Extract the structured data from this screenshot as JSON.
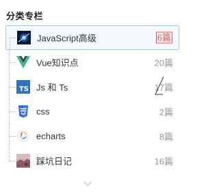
{
  "panel": {
    "title": "分类专栏"
  },
  "categories": [
    {
      "name": "JavaScript高级",
      "count": "6篇",
      "icon": "javascript-thumbnail-icon",
      "active": true
    },
    {
      "name": "Vue知识点",
      "count": "20篇",
      "icon": "vue-logo-icon",
      "active": false
    },
    {
      "name": "Js 和 Ts",
      "count": "17篇",
      "icon": "typescript-logo-icon",
      "active": false
    },
    {
      "name": "css",
      "count": "2篇",
      "icon": "css3-logo-icon",
      "active": false
    },
    {
      "name": "echarts",
      "count": "8篇",
      "icon": "echarts-logo-icon",
      "active": false
    },
    {
      "name": "踩坑日记",
      "count": "16篇",
      "icon": "landscape-photo-icon",
      "active": false
    }
  ],
  "icons": {
    "ts_label": "TS",
    "css_label": "CSS",
    "more": "chevron-down-icon"
  },
  "colors": {
    "active_border": "#9ec8f0",
    "active_bg": "#f4f9ff",
    "highlight_count": "#e2574c",
    "vue_green": "#41b883",
    "vue_dark": "#35495e",
    "ts_blue": "#2f74c0",
    "css_blue": "#2965f1"
  }
}
